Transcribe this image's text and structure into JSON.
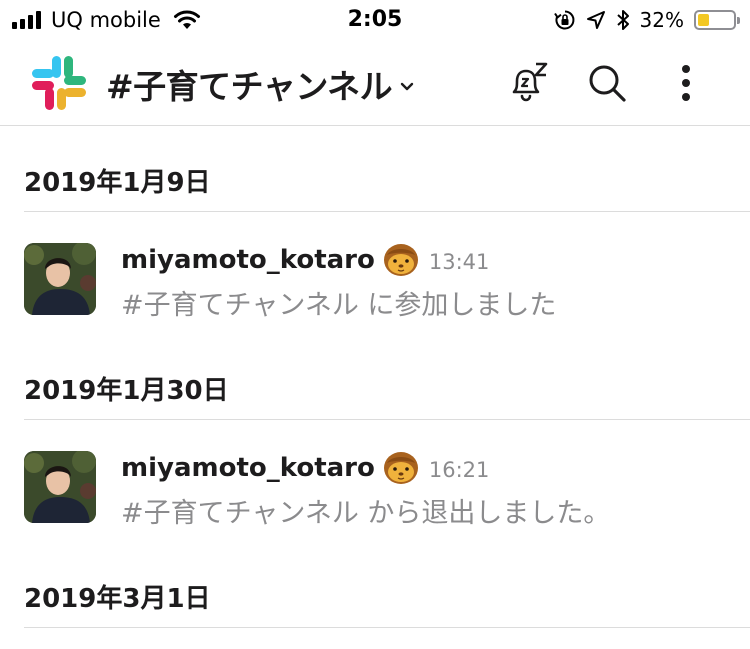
{
  "status_bar": {
    "carrier": "UQ mobile",
    "time": "2:05",
    "battery_percent_label": "32%",
    "battery_level": 0.32,
    "battery_color": "#f3c824"
  },
  "header": {
    "logo": "slack-logo",
    "channel_name": "#子育てチャンネル",
    "icons": [
      "chevron-down-icon",
      "snooze-bell-icon",
      "search-icon",
      "more-vertical-icon"
    ]
  },
  "messages": [
    {
      "date": "2019年1月9日",
      "username": "miyamoto_kotaro",
      "status_emoji": "monkey-face-icon",
      "time": "13:41",
      "text": "#子育てチャンネル に参加しました"
    },
    {
      "date": "2019年1月30日",
      "username": "miyamoto_kotaro",
      "status_emoji": "monkey-face-icon",
      "time": "16:21",
      "text": "#子育てチャンネル から退出しました。"
    }
  ],
  "trailing_date": "2019年3月1日",
  "colors": {
    "text": "#1d1c1d",
    "muted": "#8b8b8d",
    "divider": "#dcdcdc"
  }
}
